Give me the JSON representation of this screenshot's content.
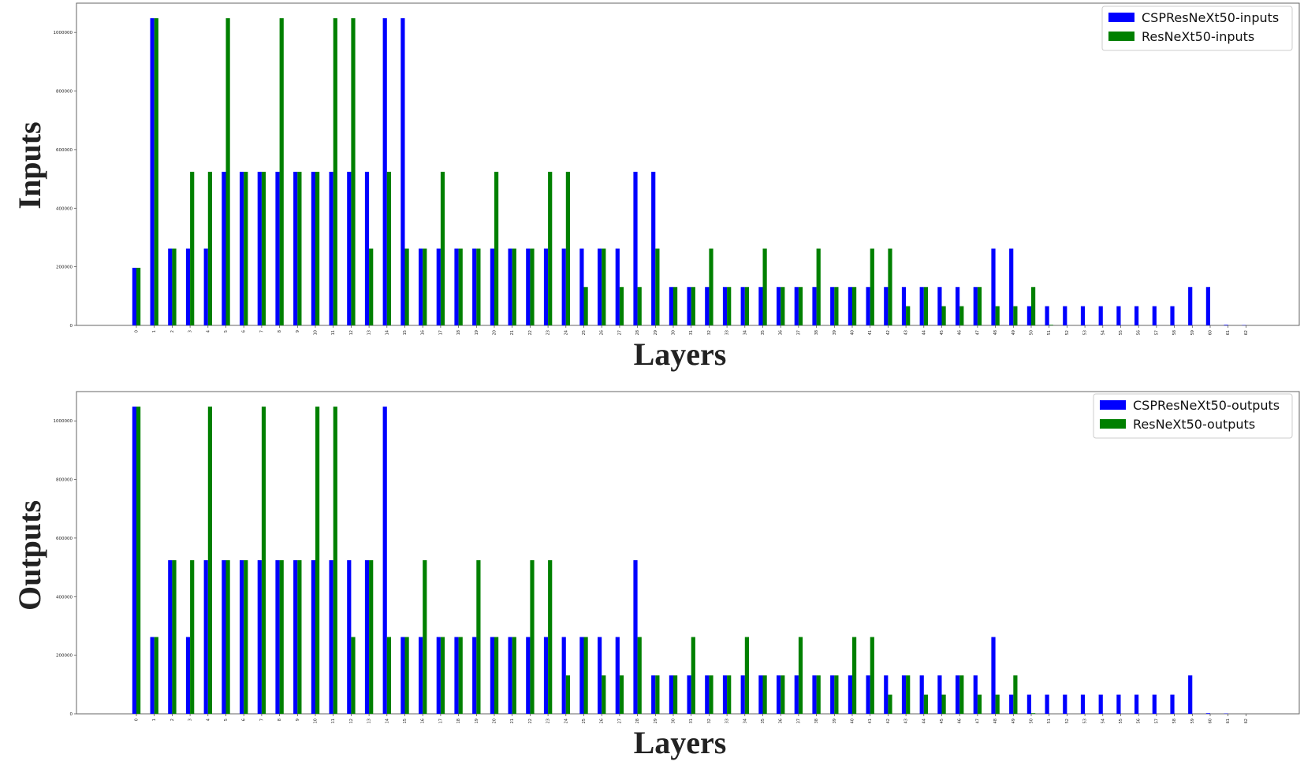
{
  "chart_data": [
    {
      "type": "bar",
      "xlabel": "Layers",
      "ylabel": "Inputs",
      "ylim": [
        0,
        1100000
      ],
      "yticks": [
        "0",
        "200000",
        "400000",
        "600000",
        "800000",
        "1000000"
      ],
      "categories": [
        "0",
        "1",
        "2",
        "3",
        "4",
        "5",
        "6",
        "7",
        "8",
        "9",
        "10",
        "11",
        "12",
        "13",
        "14",
        "15",
        "16",
        "17",
        "18",
        "19",
        "20",
        "21",
        "22",
        "23",
        "24",
        "25",
        "26",
        "27",
        "28",
        "29",
        "30",
        "31",
        "32",
        "33",
        "34",
        "35",
        "36",
        "37",
        "38",
        "39",
        "40",
        "41",
        "42",
        "43",
        "44",
        "45",
        "46",
        "47",
        "48",
        "49",
        "50",
        "51",
        "52",
        "53",
        "54",
        "55",
        "56",
        "57",
        "58",
        "59",
        "60",
        "61",
        "62"
      ],
      "legend_position": "top-right",
      "series": [
        {
          "name": "CSPResNeXt50-inputs",
          "color": "#0000ff",
          "values": [
            196608,
            1048576,
            262144,
            262144,
            262144,
            524288,
            524288,
            524288,
            524288,
            524288,
            524288,
            524288,
            524288,
            524288,
            1048576,
            1048576,
            262144,
            262144,
            262144,
            262144,
            262144,
            262144,
            262144,
            262144,
            262144,
            262144,
            262144,
            262144,
            524288,
            524288,
            131072,
            131072,
            131072,
            131072,
            131072,
            131072,
            131072,
            131072,
            131072,
            131072,
            131072,
            131072,
            131072,
            131072,
            131072,
            131072,
            131072,
            131072,
            262144,
            262144,
            65536,
            65536,
            65536,
            65536,
            65536,
            65536,
            65536,
            65536,
            65536,
            131072,
            131072,
            2048,
            1000
          ]
        },
        {
          "name": "ResNeXt50-inputs",
          "color": "#008000",
          "values": [
            196608,
            1048576,
            262144,
            524288,
            524288,
            1048576,
            524288,
            524288,
            1048576,
            524288,
            524288,
            1048576,
            1048576,
            262144,
            524288,
            262144,
            262144,
            524288,
            262144,
            262144,
            524288,
            262144,
            262144,
            524288,
            524288,
            131072,
            262144,
            131072,
            131072,
            262144,
            131072,
            131072,
            262144,
            131072,
            131072,
            262144,
            131072,
            131072,
            262144,
            131072,
            131072,
            262144,
            262144,
            65536,
            131072,
            65536,
            65536,
            131072,
            65536,
            65536,
            131072,
            2048,
            0,
            0,
            0,
            0,
            0,
            0,
            0,
            0,
            0,
            0,
            0
          ]
        }
      ]
    },
    {
      "type": "bar",
      "xlabel": "Layers",
      "ylabel": "Outputs",
      "ylim": [
        0,
        1100000
      ],
      "yticks": [
        "0",
        "200000",
        "400000",
        "600000",
        "800000",
        "1000000"
      ],
      "categories": [
        "0",
        "1",
        "2",
        "3",
        "4",
        "5",
        "6",
        "7",
        "8",
        "9",
        "10",
        "11",
        "12",
        "13",
        "14",
        "15",
        "16",
        "17",
        "18",
        "19",
        "20",
        "21",
        "22",
        "23",
        "24",
        "25",
        "26",
        "27",
        "28",
        "29",
        "30",
        "31",
        "32",
        "33",
        "34",
        "35",
        "36",
        "37",
        "38",
        "39",
        "40",
        "41",
        "42",
        "43",
        "44",
        "45",
        "46",
        "47",
        "48",
        "49",
        "50",
        "51",
        "52",
        "53",
        "54",
        "55",
        "56",
        "57",
        "58",
        "59",
        "60",
        "61",
        "62"
      ],
      "legend_position": "top-right",
      "series": [
        {
          "name": "CSPResNeXt50-outputs",
          "color": "#0000ff",
          "values": [
            1048576,
            262144,
            524288,
            262144,
            524288,
            524288,
            524288,
            524288,
            524288,
            524288,
            524288,
            524288,
            524288,
            524288,
            1048576,
            262144,
            262144,
            262144,
            262144,
            262144,
            262144,
            262144,
            262144,
            262144,
            262144,
            262144,
            262144,
            262144,
            524288,
            131072,
            131072,
            131072,
            131072,
            131072,
            131072,
            131072,
            131072,
            131072,
            131072,
            131072,
            131072,
            131072,
            131072,
            131072,
            131072,
            131072,
            131072,
            131072,
            262144,
            65536,
            65536,
            65536,
            65536,
            65536,
            65536,
            65536,
            65536,
            65536,
            65536,
            131072,
            2048,
            1000,
            0
          ]
        },
        {
          "name": "ResNeXt50-outputs",
          "color": "#008000",
          "values": [
            1048576,
            262144,
            524288,
            524288,
            1048576,
            524288,
            524288,
            1048576,
            524288,
            524288,
            1048576,
            1048576,
            262144,
            524288,
            262144,
            262144,
            524288,
            262144,
            262144,
            524288,
            262144,
            262144,
            524288,
            524288,
            131072,
            262144,
            131072,
            131072,
            262144,
            131072,
            131072,
            262144,
            131072,
            131072,
            262144,
            131072,
            131072,
            262144,
            131072,
            131072,
            262144,
            262144,
            65536,
            131072,
            65536,
            65536,
            131072,
            65536,
            65536,
            131072,
            2048,
            0,
            0,
            0,
            0,
            0,
            0,
            0,
            0,
            0,
            0,
            0,
            0
          ]
        }
      ]
    }
  ]
}
